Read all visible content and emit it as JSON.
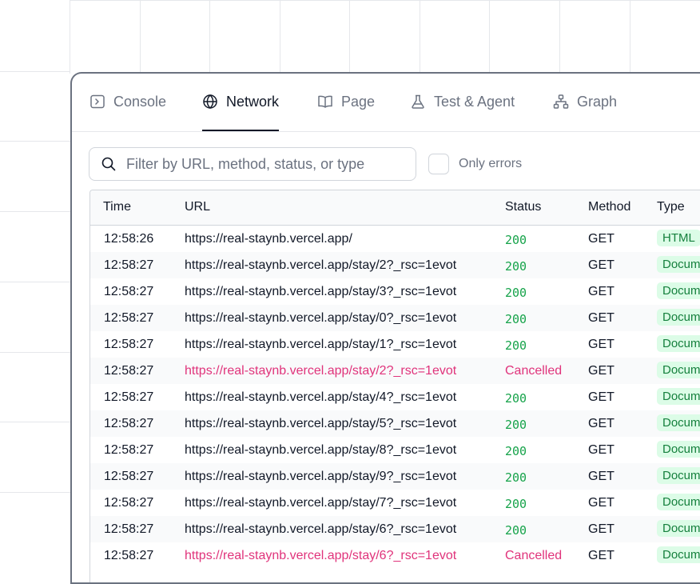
{
  "tabs": [
    {
      "label": "Console",
      "icon": "console-icon",
      "active": false
    },
    {
      "label": "Network",
      "icon": "globe-icon",
      "active": true
    },
    {
      "label": "Page",
      "icon": "book-icon",
      "active": false
    },
    {
      "label": "Test & Agent",
      "icon": "flask-icon",
      "active": false
    },
    {
      "label": "Graph",
      "icon": "sitemap-icon",
      "active": false
    }
  ],
  "filter": {
    "placeholder": "Filter by URL, method, status, or type",
    "value": ""
  },
  "only_errors": {
    "label": "Only errors",
    "checked": false
  },
  "table": {
    "headers": {
      "time": "Time",
      "url": "URL",
      "status": "Status",
      "method": "Method",
      "type": "Type"
    },
    "rows": [
      {
        "time": "12:58:26",
        "url": "https://real-staynb.vercel.app/",
        "status": "200",
        "method": "GET",
        "type": "HTML"
      },
      {
        "time": "12:58:27",
        "url": "https://real-staynb.vercel.app/stay/2?_rsc=1evot",
        "status": "200",
        "method": "GET",
        "type": "Document"
      },
      {
        "time": "12:58:27",
        "url": "https://real-staynb.vercel.app/stay/3?_rsc=1evot",
        "status": "200",
        "method": "GET",
        "type": "Document"
      },
      {
        "time": "12:58:27",
        "url": "https://real-staynb.vercel.app/stay/0?_rsc=1evot",
        "status": "200",
        "method": "GET",
        "type": "Document"
      },
      {
        "time": "12:58:27",
        "url": "https://real-staynb.vercel.app/stay/1?_rsc=1evot",
        "status": "200",
        "method": "GET",
        "type": "Document"
      },
      {
        "time": "12:58:27",
        "url": "https://real-staynb.vercel.app/stay/2?_rsc=1evot",
        "status": "Cancelled",
        "method": "GET",
        "type": "Document"
      },
      {
        "time": "12:58:27",
        "url": "https://real-staynb.vercel.app/stay/4?_rsc=1evot",
        "status": "200",
        "method": "GET",
        "type": "Document"
      },
      {
        "time": "12:58:27",
        "url": "https://real-staynb.vercel.app/stay/5?_rsc=1evot",
        "status": "200",
        "method": "GET",
        "type": "Document"
      },
      {
        "time": "12:58:27",
        "url": "https://real-staynb.vercel.app/stay/8?_rsc=1evot",
        "status": "200",
        "method": "GET",
        "type": "Document"
      },
      {
        "time": "12:58:27",
        "url": "https://real-staynb.vercel.app/stay/9?_rsc=1evot",
        "status": "200",
        "method": "GET",
        "type": "Document"
      },
      {
        "time": "12:58:27",
        "url": "https://real-staynb.vercel.app/stay/7?_rsc=1evot",
        "status": "200",
        "method": "GET",
        "type": "Document"
      },
      {
        "time": "12:58:27",
        "url": "https://real-staynb.vercel.app/stay/6?_rsc=1evot",
        "status": "200",
        "method": "GET",
        "type": "Document"
      },
      {
        "time": "12:58:27",
        "url": "https://real-staynb.vercel.app/stay/6?_rsc=1evot",
        "status": "Cancelled",
        "method": "GET",
        "type": "Document"
      }
    ]
  },
  "colors": {
    "success": "#16a34a",
    "error": "#e0337b",
    "type_badge_bg": "#dcfce7",
    "type_badge_text": "#15803d"
  }
}
